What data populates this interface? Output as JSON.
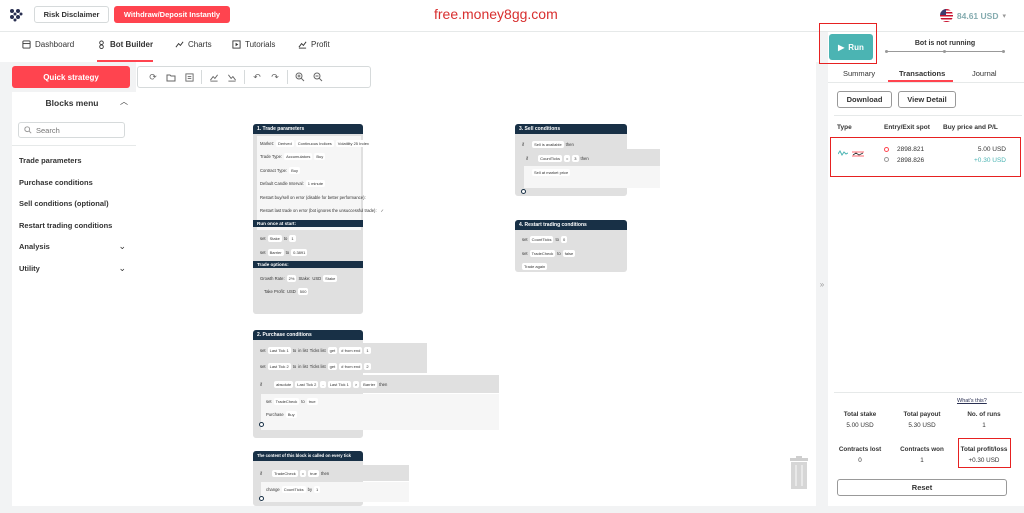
{
  "header": {
    "risk_disclaimer": "Risk Disclaimer",
    "withdraw_deposit": "Withdraw/Deposit Instantly",
    "watermark": "free.money8gg.com",
    "balance": "84.61 USD"
  },
  "nav": {
    "tabs": [
      {
        "label": "Dashboard",
        "icon": "dashboard-icon"
      },
      {
        "label": "Bot Builder",
        "icon": "bot-builder-icon",
        "active": true
      },
      {
        "label": "Charts",
        "icon": "charts-icon"
      },
      {
        "label": "Tutorials",
        "icon": "tutorials-icon"
      },
      {
        "label": "Profit",
        "icon": "profit-icon"
      }
    ]
  },
  "leftpanel": {
    "quick_strategy": "Quick strategy",
    "blocks_menu_title": "Blocks menu",
    "search_placeholder": "Search",
    "items": [
      {
        "label": "Trade parameters"
      },
      {
        "label": "Purchase conditions"
      },
      {
        "label": "Sell conditions (optional)"
      },
      {
        "label": "Restart trading conditions"
      },
      {
        "label": "Analysis"
      },
      {
        "label": "Utility"
      }
    ]
  },
  "blocks": {
    "trade_params": {
      "title": "1. Trade parameters",
      "market_label": "Market:",
      "market_values": [
        "Derived",
        "Continuous Indices",
        "Volatility 25 Index"
      ],
      "trade_type_label": "Trade Type:",
      "trade_type_values": [
        "Accumulators",
        "Buy"
      ],
      "contract_type_label": "Contract Type:",
      "contract_type_value": "Buy",
      "candle_interval_label": "Default Candle Interval:",
      "candle_interval_value": "1 minute",
      "restart_buy_sell": "Restart buy/sell on error (disable for better performance):",
      "restart_last_trade": "Restart last trade on error (bot ignores the unsuccessful trade):",
      "run_once": "Run once at start:",
      "set_label": "set",
      "to_label": "to",
      "stake_var": "Stake",
      "stake_value": "1",
      "barrier_var": "Barrier",
      "barrier_value": "0.3891",
      "trade_options": "Trade options:",
      "growth_rate_label": "Growth Rate:",
      "growth_rate_value": "2%",
      "stake_label": "Stake:",
      "usd_label": "USD",
      "take_profit_label": "Take Profit:",
      "take_profit_value": "500"
    },
    "purchase": {
      "title": "2. Purchase conditions",
      "set_label": "set",
      "to_label": "to",
      "in_list": "in list",
      "ticks_list": "Ticks list",
      "get": "get",
      "from_end": "# from end",
      "last_tick_1": "Last Tick 1",
      "last_tick_2": "Last Tick 2",
      "n1": "1",
      "n2": "2",
      "if_label": "if",
      "absolute": "absolute",
      "minus": "-",
      "gt": ">",
      "barrier": "Barrier",
      "then": "then",
      "tradecheck": "TradeCheck",
      "true_val": "true",
      "purchase_label": "Purchase",
      "buy": "Buy"
    },
    "every_tick": {
      "title": "The content of this block is called on every tick",
      "if_label": "if",
      "tradecheck": "TradeCheck",
      "eq": "=",
      "true_val": "true",
      "then": "then",
      "change": "change",
      "countticks": "CountTicks",
      "by": "by",
      "by_val": "1"
    },
    "sell": {
      "title": "3. Sell conditions",
      "if_label": "if",
      "sell_available": "Sell is available",
      "then": "then",
      "countticks": "CountTicks",
      "eq": "=",
      "three": "3",
      "sell_market": "Sell at market price"
    },
    "restart": {
      "title": "4. Restart trading conditions",
      "set_label": "set",
      "to_label": "to",
      "countticks": "CountTicks",
      "zero": "0",
      "tradecheck": "TradeCheck",
      "false_val": "false",
      "trade_again": "Trade again"
    }
  },
  "rightpanel": {
    "run": "Run",
    "bot_status": "Bot is not running",
    "tabs": [
      "Summary",
      "Transactions",
      "Journal"
    ],
    "download": "Download",
    "view_detail": "View Detail",
    "columns": [
      "Type",
      "Entry/Exit spot",
      "Buy price and P/L"
    ],
    "transaction": {
      "entry_spot": "2898.821",
      "exit_spot": "2898.826",
      "buy_price": "5.00 USD",
      "pl": "+0.30 USD"
    },
    "whats_this": "What's this?",
    "stats": {
      "total_stake_label": "Total stake",
      "total_stake": "5.00 USD",
      "total_payout_label": "Total payout",
      "total_payout": "5.30 USD",
      "runs_label": "No. of runs",
      "runs": "1",
      "contracts_lost_label": "Contracts lost",
      "contracts_lost": "0",
      "contracts_won_label": "Contracts won",
      "contracts_won": "1",
      "total_profit_label": "Total profit/loss",
      "total_profit": "+0.30 USD"
    },
    "reset": "Reset"
  },
  "colors": {
    "accent_red": "#ff444f",
    "run_teal": "#4bb4b3",
    "block_header": "#183046",
    "highlight_red": "#e62121"
  }
}
